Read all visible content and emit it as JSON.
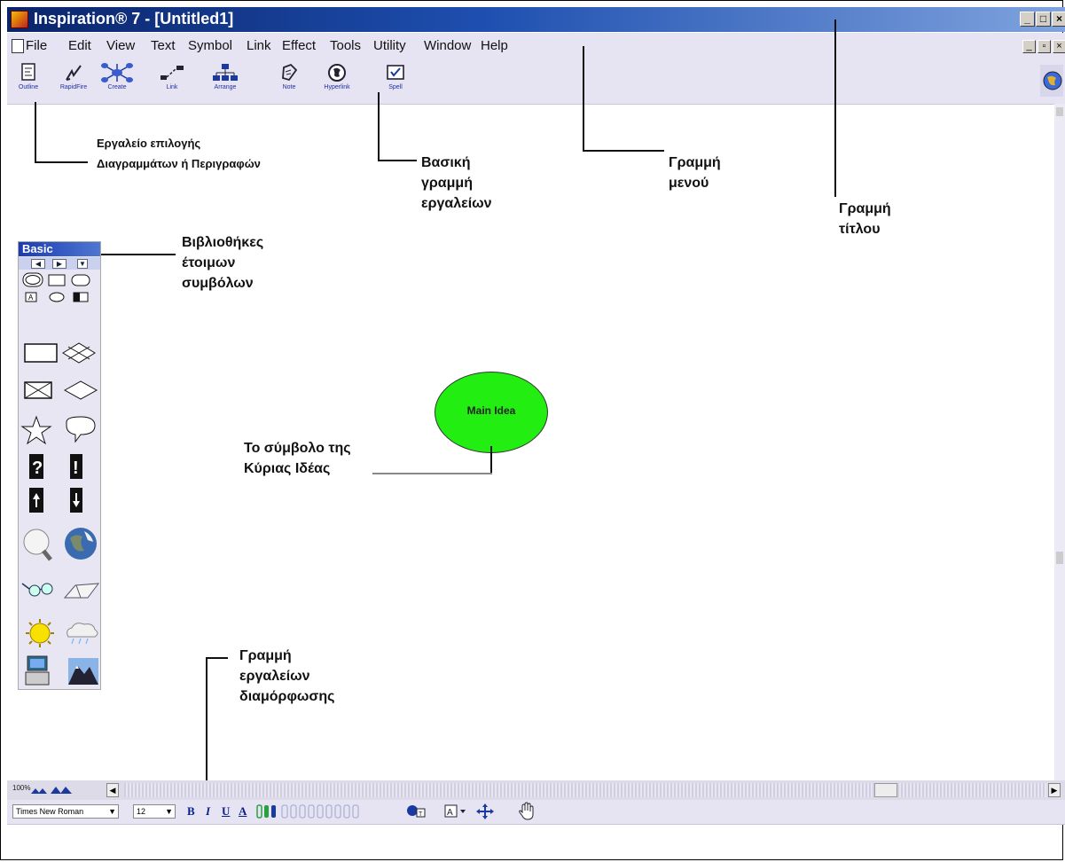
{
  "window": {
    "title": "Inspiration® 7 - [Untitled1]",
    "minimize_glyph": "_",
    "maximize_glyph": "□",
    "close_glyph": "×"
  },
  "menubar": {
    "items": [
      "File",
      "Edit",
      "View",
      "Text",
      "Symbol",
      "Link",
      "Effect",
      "Tools",
      "Utility",
      "Window",
      "Help"
    ]
  },
  "toolbar": {
    "tools": [
      {
        "label": "Outline",
        "icon": "outline-icon"
      },
      {
        "label": "RapidFire",
        "icon": "rapidfire-icon"
      },
      {
        "label": "Create",
        "icon": "create-icon"
      },
      {
        "label": "Link",
        "icon": "link-icon"
      },
      {
        "label": "Arrange",
        "icon": "arrange-icon"
      },
      {
        "label": "Note",
        "icon": "note-icon"
      },
      {
        "label": "Hyperlink",
        "icon": "hyperlink-icon"
      },
      {
        "label": "Spell",
        "icon": "spell-icon"
      }
    ]
  },
  "palette": {
    "title": "Basic"
  },
  "canvas": {
    "main_idea": "Main Idea"
  },
  "annotations": {
    "outline_tool": [
      "Εργαλείο επιλογής",
      "Διαγραμμάτων ή Περιγραφών"
    ],
    "main_toolbar": [
      "Βασική",
      "γραμμή",
      "εργαλείων"
    ],
    "menu_bar": [
      "Γραμμή",
      "μενού"
    ],
    "title_bar": [
      "Γραμμή",
      "τίτλου"
    ],
    "symbol_libraries": [
      "Βιβλιοθήκες",
      "έτοιμων",
      "συμβόλων"
    ],
    "main_idea_symbol": [
      "Το σύμβολο της",
      "Κύριας Ιδέας"
    ],
    "formatting_toolbar": [
      "Γραμμή",
      "εργαλείων",
      "διαμόρφωσης"
    ]
  },
  "view": {
    "zoom": "100%"
  },
  "formatting": {
    "font": "Times New Roman",
    "size": "12",
    "bold": "B",
    "italic": "I",
    "underline": "U",
    "text_color": "A"
  },
  "colors": {
    "title_bar": "#0a246a",
    "main_idea_fill": "#22ee11",
    "toolbar_bg": "#e6e4f2"
  }
}
